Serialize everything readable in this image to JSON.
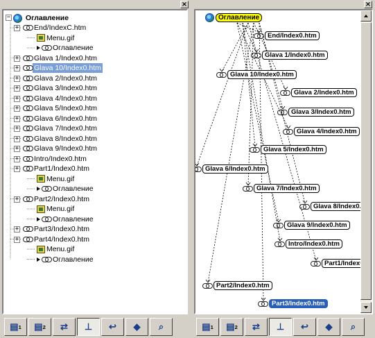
{
  "left": {
    "close_label": "×",
    "root_label": "Оглавление",
    "items": [
      {
        "label": "End/IndexC.htm",
        "kind": "link",
        "selected": false
      },
      {
        "label": "Menu.gif",
        "kind": "image",
        "selected": false
      },
      {
        "label": "Оглавление",
        "kind": "arrow",
        "selected": false
      },
      {
        "label": "Glava 1/Index0.htm",
        "kind": "link",
        "selected": false
      },
      {
        "label": "Glava 10/Index0.htm",
        "kind": "link",
        "selected": true
      },
      {
        "label": "Glava 2/Index0.htm",
        "kind": "link",
        "selected": false
      },
      {
        "label": "Glava 3/Index0.htm",
        "kind": "link",
        "selected": false
      },
      {
        "label": "Glava 4/Index0.htm",
        "kind": "link",
        "selected": false
      },
      {
        "label": "Glava 5/Index0.htm",
        "kind": "link",
        "selected": false
      },
      {
        "label": "Glava 6/Index0.htm",
        "kind": "link",
        "selected": false
      },
      {
        "label": "Glava 7/Index0.htm",
        "kind": "link",
        "selected": false
      },
      {
        "label": "Glava 8/Index0.htm",
        "kind": "link",
        "selected": false
      },
      {
        "label": "Glava 9/Index0.htm",
        "kind": "link",
        "selected": false
      },
      {
        "label": "Intro/Index0.htm",
        "kind": "link",
        "selected": false
      },
      {
        "label": "Part1/Index0.htm",
        "kind": "link",
        "selected": false
      },
      {
        "label": "Menu.gif",
        "kind": "image",
        "selected": false
      },
      {
        "label": "Оглавление",
        "kind": "arrow",
        "selected": false
      },
      {
        "label": "Part2/Index0.htm",
        "kind": "link",
        "selected": false
      },
      {
        "label": "Menu.gif",
        "kind": "image",
        "selected": false
      },
      {
        "label": "Оглавление",
        "kind": "arrow",
        "selected": false
      },
      {
        "label": "Part3/Index0.htm",
        "kind": "link",
        "selected": false
      },
      {
        "label": "Part4/Index0.htm",
        "kind": "link",
        "selected": false
      },
      {
        "label": "Menu.gif",
        "kind": "image",
        "selected": false
      },
      {
        "label": "Оглавление",
        "kind": "arrow",
        "selected": false
      }
    ],
    "tabs": [
      "1",
      "2",
      "",
      "",
      "",
      "",
      ""
    ]
  },
  "right": {
    "close_label": "×",
    "root_label": "Оглавление",
    "nodes": [
      {
        "label": "End/Index0.htm"
      },
      {
        "label": "Glava 1/Index0.htm"
      },
      {
        "label": "Glava 10/Index0.htm"
      },
      {
        "label": "Glava 2/Index0.htm"
      },
      {
        "label": "Glava 3/Index0.htm"
      },
      {
        "label": "Glava 4/Index0.htm"
      },
      {
        "label": "Glava 5/Index0.htm"
      },
      {
        "label": "Glava 6/Index0.htm"
      },
      {
        "label": "Glava 7/Index0.htm"
      },
      {
        "label": "Glava 8/Index0.htm"
      },
      {
        "label": "Glava 9/Index0.htm"
      },
      {
        "label": "Intro/Index0.htm"
      },
      {
        "label": "Part1/Index0.htm"
      },
      {
        "label": "Part2/Index0.htm"
      },
      {
        "label": "Part3/Index0.htm"
      }
    ],
    "tabs": [
      "1",
      "2",
      "",
      "",
      "",
      "",
      ""
    ]
  },
  "colors": {
    "root_node": "#ffff00",
    "selected_node": "#2a5fb8",
    "tree_selection": "#7a9ed8"
  }
}
